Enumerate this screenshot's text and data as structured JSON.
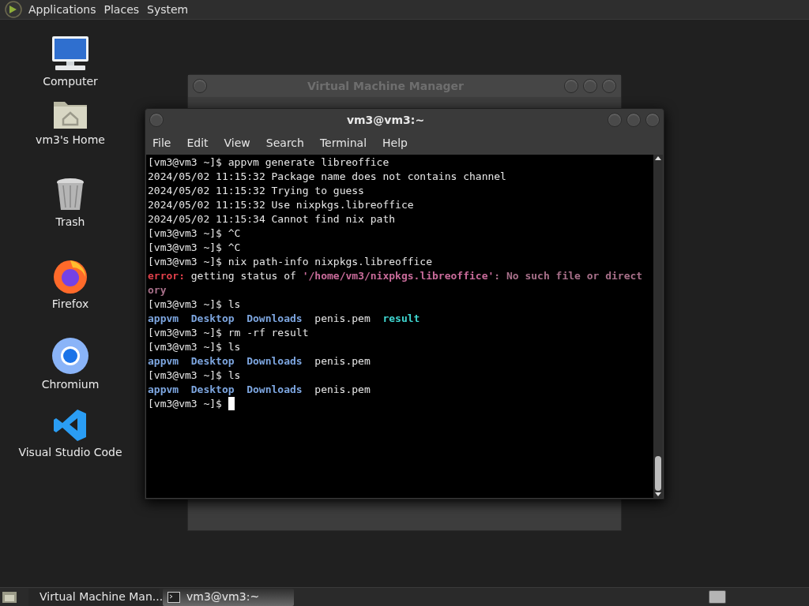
{
  "top_panel": {
    "menus": [
      "Applications",
      "Places",
      "System"
    ]
  },
  "desktop_icons": [
    {
      "kind": "computer",
      "label": "Computer"
    },
    {
      "kind": "home",
      "label": "vm3's Home"
    },
    {
      "kind": "trash",
      "label": "Trash"
    },
    {
      "kind": "firefox",
      "label": "Firefox"
    },
    {
      "kind": "chromium",
      "label": "Chromium"
    },
    {
      "kind": "vscode",
      "label": "Visual Studio Code"
    }
  ],
  "background_window": {
    "title": "Virtual Machine Manager"
  },
  "terminal": {
    "title": "vm3@vm3:~",
    "menus": [
      "File",
      "Edit",
      "View",
      "Search",
      "Terminal",
      "Help"
    ],
    "lines": [
      [
        {
          "kind": "plain",
          "text": "[vm3@vm3 ~]$ appvm generate libreoffice"
        }
      ],
      [
        {
          "kind": "plain",
          "text": "2024/05/02 11:15:32 Package name does not contains channel"
        }
      ],
      [
        {
          "kind": "plain",
          "text": "2024/05/02 11:15:32 Trying to guess"
        }
      ],
      [
        {
          "kind": "plain",
          "text": "2024/05/02 11:15:32 Use nixpkgs.libreoffice"
        }
      ],
      [
        {
          "kind": "plain",
          "text": "2024/05/02 11:15:34 Cannot find nix path"
        }
      ],
      [
        {
          "kind": "plain",
          "text": "[vm3@vm3 ~]$ ^C"
        }
      ],
      [
        {
          "kind": "plain",
          "text": "[vm3@vm3 ~]$ ^C"
        }
      ],
      [
        {
          "kind": "plain",
          "text": "[vm3@vm3 ~]$ nix path-info nixpkgs.libreoffice"
        }
      ],
      [
        {
          "kind": "error_label",
          "text": "error:"
        },
        {
          "kind": "plain",
          "text": " getting status of "
        },
        {
          "kind": "error_path",
          "text": "'/home/vm3/nixpkgs.libreoffice'"
        },
        {
          "kind": "error_text",
          "text": ": No such file or direct"
        }
      ],
      [
        {
          "kind": "error_text",
          "text": "ory"
        }
      ],
      [
        {
          "kind": "plain",
          "text": "[vm3@vm3 ~]$ ls"
        }
      ],
      [
        {
          "kind": "dir",
          "text": "appvm"
        },
        {
          "kind": "gap"
        },
        {
          "kind": "dir",
          "text": "Desktop"
        },
        {
          "kind": "gap"
        },
        {
          "kind": "dir",
          "text": "Downloads"
        },
        {
          "kind": "gap"
        },
        {
          "kind": "plain",
          "text": "penis.pem"
        },
        {
          "kind": "gap"
        },
        {
          "kind": "link",
          "text": "result"
        }
      ],
      [
        {
          "kind": "plain",
          "text": "[vm3@vm3 ~]$ rm -rf result"
        }
      ],
      [
        {
          "kind": "plain",
          "text": "[vm3@vm3 ~]$ ls"
        }
      ],
      [
        {
          "kind": "dir",
          "text": "appvm"
        },
        {
          "kind": "gap"
        },
        {
          "kind": "dir",
          "text": "Desktop"
        },
        {
          "kind": "gap"
        },
        {
          "kind": "dir",
          "text": "Downloads"
        },
        {
          "kind": "gap"
        },
        {
          "kind": "plain",
          "text": "penis.pem"
        }
      ],
      [
        {
          "kind": "plain",
          "text": "[vm3@vm3 ~]$ ls"
        }
      ],
      [
        {
          "kind": "dir",
          "text": "appvm"
        },
        {
          "kind": "gap"
        },
        {
          "kind": "dir",
          "text": "Desktop"
        },
        {
          "kind": "gap"
        },
        {
          "kind": "dir",
          "text": "Downloads"
        },
        {
          "kind": "gap"
        },
        {
          "kind": "plain",
          "text": "penis.pem"
        }
      ],
      [
        {
          "kind": "plain",
          "text": "[vm3@vm3 ~]$"
        },
        {
          "kind": "cursor"
        }
      ]
    ]
  },
  "taskbar": {
    "tasks": [
      {
        "kind": "vmm",
        "label": "Virtual Machine Man...",
        "selected": false
      },
      {
        "kind": "terminal",
        "label": "vm3@vm3:~",
        "selected": true
      }
    ]
  }
}
